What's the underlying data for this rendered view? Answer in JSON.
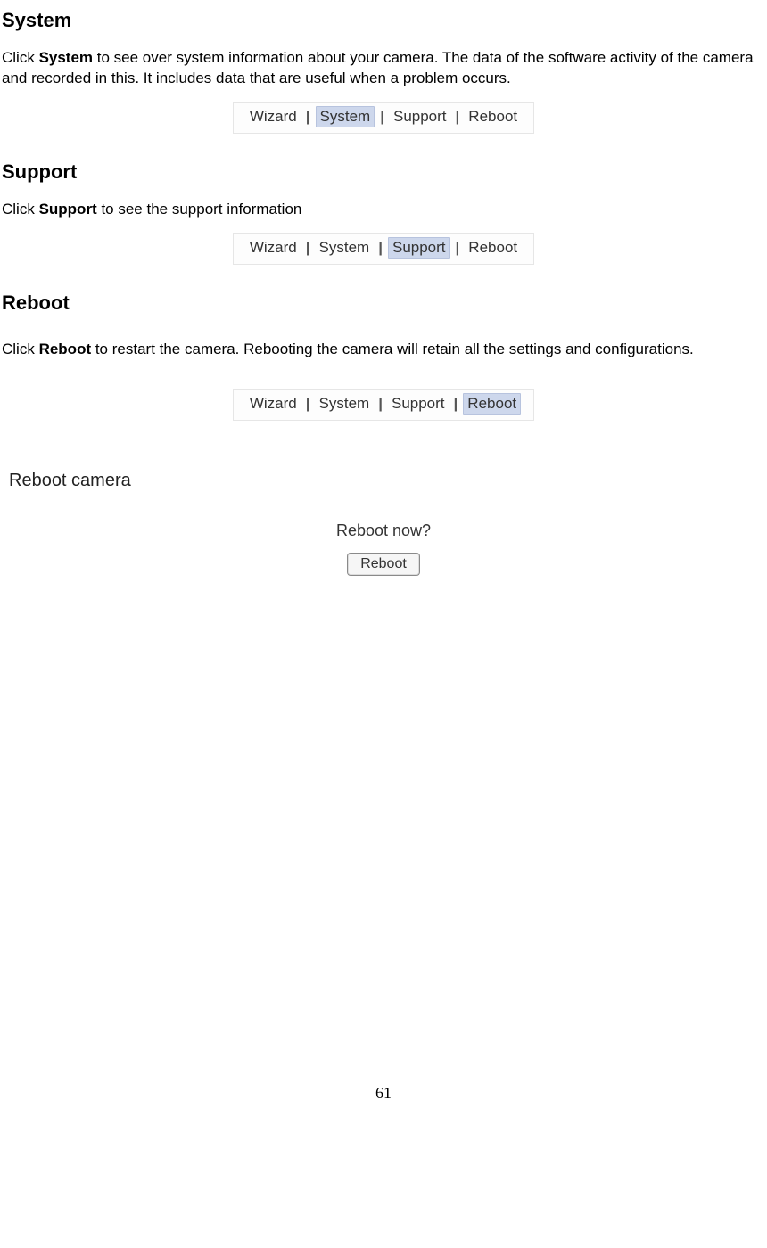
{
  "sections": {
    "system": {
      "heading": "System",
      "para_prefix": "Click ",
      "para_bold": "System",
      "para_suffix": " to see over system information about your camera. The data of the software activity of the camera and recorded in this. It includes data that are useful when a problem occurs."
    },
    "support": {
      "heading": "Support",
      "para_prefix": "Click ",
      "para_bold": "Support",
      "para_suffix": " to see the support information"
    },
    "reboot": {
      "heading": "Reboot",
      "para_prefix": "Click ",
      "para_bold": "Reboot",
      "para_suffix": " to restart the camera. Rebooting the camera will retain all the settings and configurations.",
      "panel_title": "Reboot camera",
      "question": "Reboot now?",
      "button": "Reboot"
    }
  },
  "nav": {
    "items": [
      "Wizard",
      "System",
      "Support",
      "Reboot"
    ],
    "sep": "|"
  },
  "page_number": "61"
}
